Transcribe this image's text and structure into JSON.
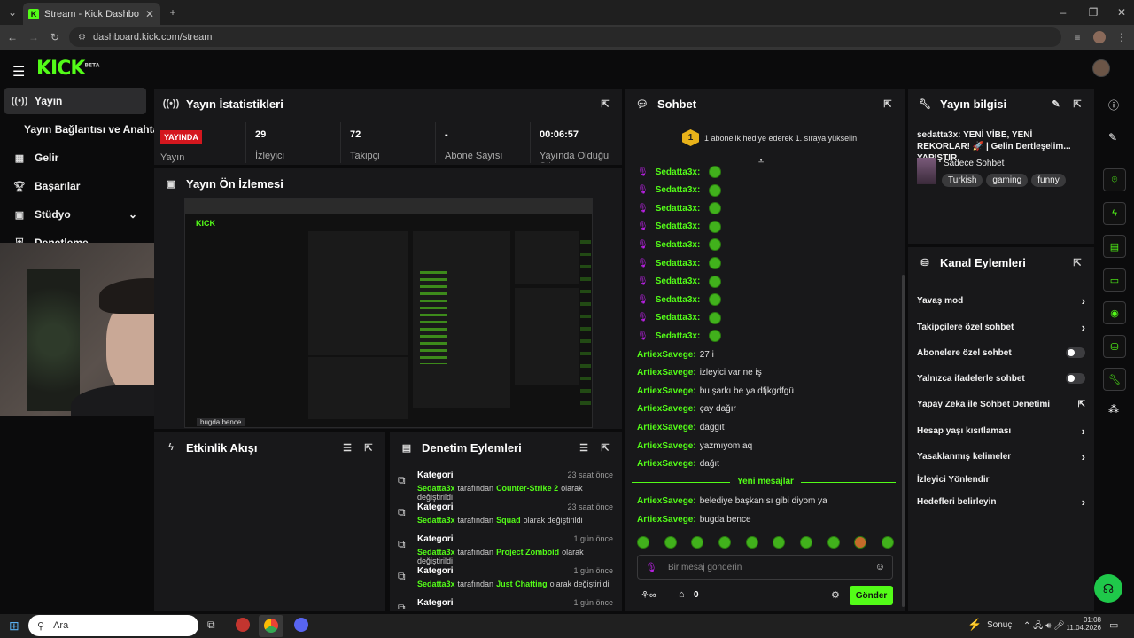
{
  "browser": {
    "tab_title": "Stream - Kick Dashboard",
    "url": "dashboard.kick.com/stream"
  },
  "brand": {
    "logo": "KICK",
    "beta": "BETA",
    "accent": "#53fc18"
  },
  "nav": {
    "items": [
      {
        "label": "Yayın",
        "icon": "broadcast-icon"
      },
      {
        "label": "Yayın Bağlantısı ve Anahtarı",
        "icon": ""
      },
      {
        "label": "Gelir",
        "icon": "revenue-icon"
      },
      {
        "label": "Başarılar",
        "icon": "trophy-icon"
      },
      {
        "label": "Stüdyo",
        "icon": "studio-icon"
      },
      {
        "label": "Denetleme",
        "icon": "moderation-icon"
      }
    ]
  },
  "stats": {
    "title": "Yayın İstatistikleri",
    "live_badge": "YAYINDA",
    "live_label": "Yayın",
    "viewers": "29",
    "viewers_label": "İzleyici",
    "followers": "72",
    "followers_label": "Takipçi",
    "subs": "-",
    "subs_label": "Abone Sayısı",
    "uptime": "00:06:57",
    "uptime_label": "Yayında Olduğu Süre"
  },
  "preview": {
    "title": "Yayın Ön İzlemesi"
  },
  "activity": {
    "title": "Etkinlik Akışı"
  },
  "modlog": {
    "title": "Denetim Eylemleri",
    "items": [
      {
        "kind": "Kategori",
        "time": "23 saat önce",
        "user": "Sedatta3x",
        "mid": "tarafından",
        "value": "Counter-Strike 2",
        "end": "olarak değiştirildi"
      },
      {
        "kind": "Kategori",
        "time": "23 saat önce",
        "user": "Sedatta3x",
        "mid": "tarafından",
        "value": "Squad",
        "end": "olarak değiştirildi"
      },
      {
        "kind": "Kategori",
        "time": "1 gün önce",
        "user": "Sedatta3x",
        "mid": "tarafından",
        "value": "Project Zomboid",
        "end": "olarak değiştirildi"
      },
      {
        "kind": "Kategori",
        "time": "1 gün önce",
        "user": "Sedatta3x",
        "mid": "tarafından",
        "value": "Just Chatting",
        "end": "olarak değiştirildi"
      },
      {
        "kind": "Kategori",
        "time": "1 gün önce",
        "user": "",
        "mid": "",
        "value": "",
        "end": ""
      }
    ]
  },
  "chat": {
    "title": "Sohbet",
    "pinned": "1 abonelik hediye ederek 1. sıraya yükselin",
    "pinned_rank": "1",
    "emote_user": "Sedatta3x:",
    "messages": [
      {
        "user": "ArtiexSavege:",
        "text": "27 i"
      },
      {
        "user": "ArtiexSavege:",
        "text": "izleyici var ne iş"
      },
      {
        "user": "ArtiexSavege:",
        "text": "bu şarkı be ya dfjkgdfgü"
      },
      {
        "user": "ArtiexSavege:",
        "text": "çay dağır"
      },
      {
        "user": "ArtiexSavege:",
        "text": "daggıt"
      },
      {
        "user": "ArtiexSavege:",
        "text": "yazmıyom aq"
      },
      {
        "user": "ArtiexSavege:",
        "text": "dağıt"
      }
    ],
    "new_messages": "Yeni mesajlar",
    "new": [
      {
        "user": "ArtiexSavege:",
        "text": "belediye başkanısı gibi diyom ya"
      },
      {
        "user": "ArtiexSavege:",
        "text": "bugda bence"
      }
    ],
    "input_placeholder": "Bir mesaj gönderin",
    "count": "0",
    "send": "Gönder"
  },
  "info": {
    "title": "Yayın bilgisi",
    "stream_title": "sedatta3x: YENİ VİBE, YENİ REKORLAR! 🚀 | Gelin Dertleşelim... YAPIŞTIR",
    "category": "Sadece Sohbet",
    "tags": [
      "Turkish",
      "gaming",
      "funny"
    ]
  },
  "channel": {
    "title": "Kanal Eylemleri",
    "items": [
      {
        "label": "Yavaş mod",
        "ctrl": "chevron"
      },
      {
        "label": "Takipçilere özel sohbet",
        "ctrl": "chevron"
      },
      {
        "label": "Abonelere özel sohbet",
        "ctrl": "toggle"
      },
      {
        "label": "Yalnızca ifadelerle sohbet",
        "ctrl": "toggle"
      },
      {
        "label": "Yapay Zeka ile Sohbet Denetimi",
        "ctrl": "external"
      },
      {
        "label": "Hesap yaşı kısıtlaması",
        "ctrl": "chevron"
      },
      {
        "label": "Yasaklanmış kelimeler",
        "ctrl": "chevron"
      },
      {
        "label": "İzleyici Yönlendir",
        "ctrl": ""
      },
      {
        "label": "Hedefleri belirleyin",
        "ctrl": "chevron"
      }
    ]
  },
  "overlay": {
    "caption": "bugda bence"
  },
  "taskbar": {
    "search": "Ara",
    "tray_label": "Sonuç",
    "time": "01:08",
    "date": "11.04.2026"
  }
}
